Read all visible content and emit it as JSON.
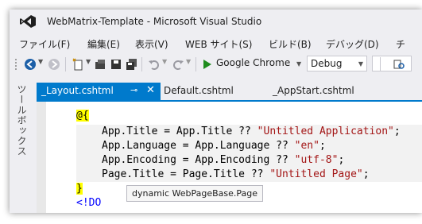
{
  "window": {
    "title": "WebMatrix-Template - Microsoft Visual Studio"
  },
  "menu": {
    "items": [
      "ファイル(F)",
      "編集(E)",
      "表示(V)",
      "WEB サイト(S)",
      "ビルド(B)",
      "デバッグ(D)",
      "チ"
    ]
  },
  "toolbar": {
    "run_target": "Google Chrome",
    "configuration": "Debug"
  },
  "sidebar": {
    "label": "ツールボックス"
  },
  "tabs": {
    "active": "_Layout.cshtml",
    "items": [
      "Default.cshtml",
      "_AppStart.cshtml"
    ]
  },
  "code": {
    "open": "@{",
    "lines": [
      {
        "lhs": "App.Title = App.Title ?? ",
        "str": "\"Untitled Application\"",
        "end": ";"
      },
      {
        "lhs": "App.Language = App.Language ?? ",
        "str": "\"en\"",
        "end": ";"
      },
      {
        "lhs": "App.Encoding = App.Encoding ?? ",
        "str": "\"utf-8\"",
        "end": ";"
      },
      {
        "lhs": "Page.Title = Page.Title ?? ",
        "str": "\"Untitled Page\"",
        "end": ";"
      }
    ],
    "close": "}",
    "next": "<!DO"
  },
  "tooltip": {
    "text": "dynamic WebPageBase.Page"
  },
  "colors": {
    "accent": "#007acc",
    "string": "#a31515",
    "razor_highlight": "#ffff00",
    "run_green": "#1e8c1e"
  }
}
